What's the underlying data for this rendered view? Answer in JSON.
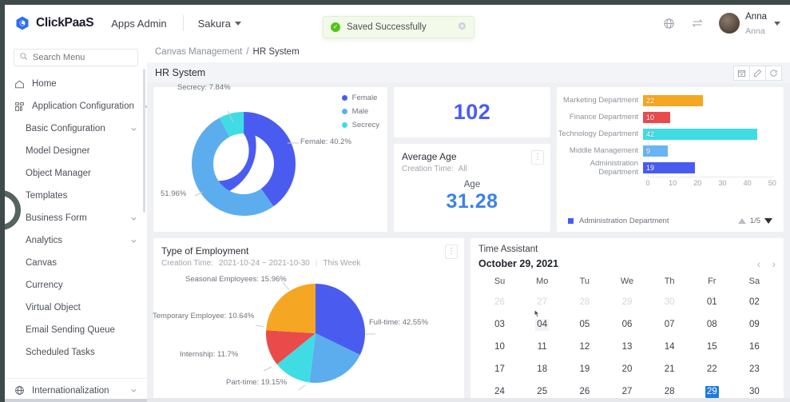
{
  "topbar": {
    "brand": "ClickPaaS",
    "apps_admin": "Apps Admin",
    "tenant": "Sakura",
    "globe_icon": "globe-icon",
    "switch_icon": "switch-icon",
    "user_name": "Anna",
    "user_sub": "Anna"
  },
  "toast": {
    "message": "Saved Successfully",
    "status_icon": "check-circle-icon",
    "close_icon": "close-circle-icon",
    "accent": "#52c41a",
    "bg": "#f3faea"
  },
  "sidebar": {
    "search_placeholder": "Search Menu",
    "search_value": "",
    "items": [
      {
        "label": "Home",
        "icon": "home-icon",
        "level": 1,
        "expandable": false
      },
      {
        "label": "Application Configuration",
        "icon": "grid-icon",
        "level": 1,
        "expandable": true,
        "expanded": true
      },
      {
        "label": "Basic Configuration",
        "icon": "",
        "level": 2,
        "expandable": true,
        "expanded": false
      },
      {
        "label": "Model Designer",
        "icon": "",
        "level": 2,
        "expandable": false
      },
      {
        "label": "Object Manager",
        "icon": "",
        "level": 2,
        "expandable": false
      },
      {
        "label": "Templates",
        "icon": "",
        "level": 2,
        "expandable": false
      },
      {
        "label": "Business Form",
        "icon": "",
        "level": 2,
        "expandable": true,
        "expanded": false
      },
      {
        "label": "Analytics",
        "icon": "",
        "level": 2,
        "expandable": true,
        "expanded": false
      },
      {
        "label": "Canvas",
        "icon": "",
        "level": 2,
        "expandable": false
      },
      {
        "label": "Currency",
        "icon": "",
        "level": 2,
        "expandable": false
      },
      {
        "label": "Virtual Object",
        "icon": "",
        "level": 2,
        "expandable": false
      },
      {
        "label": "Email Sending Queue",
        "icon": "",
        "level": 2,
        "expandable": false
      },
      {
        "label": "Scheduled Tasks",
        "icon": "",
        "level": 2,
        "expandable": false
      }
    ],
    "bottom_item": {
      "label": "Internationalization",
      "icon": "globe-icon",
      "expandable": true
    }
  },
  "breadcrumb": {
    "parent": "Canvas Management",
    "separator": "/",
    "current": "HR System"
  },
  "page": {
    "title": "HR System",
    "actions": [
      {
        "name": "calendar-filter-button",
        "icon": "calendar-icon"
      },
      {
        "name": "edit-button",
        "icon": "pencil-icon"
      },
      {
        "name": "refresh-button",
        "icon": "refresh-icon"
      }
    ]
  },
  "cards": {
    "count_card": {
      "value": "102",
      "color": "#4a5cf0"
    },
    "average_age": {
      "title": "Average Age",
      "creation_time_label": "Creation Time:",
      "creation_time_value": "All",
      "metric_label": "Age",
      "metric_value": "31.28",
      "color": "#3d82e8",
      "kebab_icon": "more-vertical-icon"
    },
    "employment": {
      "title": "Type of Employment",
      "creation_time_label": "Creation Time:",
      "creation_time_value": "2021-10-24 ~ 2021-10-30",
      "range_label": "This Week",
      "kebab_icon": "more-vertical-icon"
    }
  },
  "calendar": {
    "title": "Time Assistant",
    "current_date": "October 29, 2021",
    "prev_icon": "chevron-left-icon",
    "next_icon": "chevron-right-icon",
    "dow": [
      "Su",
      "Mo",
      "Tu",
      "We",
      "Th",
      "Fr",
      "Sa"
    ],
    "weeks": [
      [
        {
          "d": "26",
          "muted": true
        },
        {
          "d": "27",
          "muted": true
        },
        {
          "d": "28",
          "muted": true
        },
        {
          "d": "29",
          "muted": true
        },
        {
          "d": "30",
          "muted": true
        },
        {
          "d": "01"
        },
        {
          "d": "02"
        }
      ],
      [
        {
          "d": "03"
        },
        {
          "d": "04",
          "hover": true
        },
        {
          "d": "05"
        },
        {
          "d": "06"
        },
        {
          "d": "07"
        },
        {
          "d": "08"
        },
        {
          "d": "09"
        }
      ],
      [
        {
          "d": "10"
        },
        {
          "d": "11"
        },
        {
          "d": "12"
        },
        {
          "d": "13"
        },
        {
          "d": "14"
        },
        {
          "d": "15"
        },
        {
          "d": "16"
        }
      ],
      [
        {
          "d": "17"
        },
        {
          "d": "18"
        },
        {
          "d": "19"
        },
        {
          "d": "20"
        },
        {
          "d": "21"
        },
        {
          "d": "22"
        },
        {
          "d": "23"
        }
      ],
      [
        {
          "d": "24"
        },
        {
          "d": "25"
        },
        {
          "d": "26"
        },
        {
          "d": "27"
        },
        {
          "d": "28",
          "dot": true
        },
        {
          "d": "29",
          "selected": true
        },
        {
          "d": "30"
        }
      ]
    ],
    "selected_color": "#1f7ae0"
  },
  "chart_data": [
    {
      "type": "pie",
      "variant": "donut",
      "title": "",
      "categories": [
        "Female",
        "Male",
        "Secrecy"
      ],
      "values": [
        40.2,
        51.96,
        7.84
      ],
      "labels": [
        "Female: 40.2%",
        "51.96%",
        "Secrecy: 7.84%"
      ],
      "legend": [
        "Female",
        "Male",
        "Secrecy"
      ],
      "legend_position": "top-right",
      "colors": [
        "#4a5cf0",
        "#5cadee",
        "#3fdde3"
      ],
      "unit": "%"
    },
    {
      "type": "bar",
      "orientation": "horizontal",
      "title": "",
      "categories": [
        "Marketing Department",
        "Finance Department",
        "Technology Department",
        "Middle Management",
        "Administration Department"
      ],
      "values": [
        22,
        10,
        42,
        9,
        19
      ],
      "colors": [
        "#f5a623",
        "#e94b4b",
        "#3fdde3",
        "#69b4f2",
        "#4a5cf0"
      ],
      "xticks": [
        "0",
        "10",
        "20",
        "30",
        "40",
        "50"
      ],
      "xlim": [
        0,
        50
      ],
      "xlabel": "",
      "ylabel": "",
      "grid": false,
      "legend": [
        "Administration Department"
      ],
      "legend_position": "bottom-left",
      "pager": "1/5",
      "pager_up_icon": "triangle-up-icon",
      "pager_down_icon": "triangle-down-icon"
    },
    {
      "type": "pie",
      "variant": "pie",
      "title": "Type of Employment",
      "categories": [
        "Full-time",
        "Part-time",
        "Internship",
        "Temporary Employee",
        "Seasonal Employees"
      ],
      "values": [
        42.55,
        19.15,
        11.7,
        10.64,
        15.96
      ],
      "labels": [
        "Full-time: 42.55%",
        "Part-time: 19.15%",
        "Internship: 11.7%",
        "Temporary Employee: 10.64%",
        "Seasonal Employees: 15.96%"
      ],
      "colors": [
        "#4a5cf0",
        "#5cadee",
        "#3fdde3",
        "#e94b4b",
        "#f5a623"
      ],
      "unit": "%"
    }
  ]
}
